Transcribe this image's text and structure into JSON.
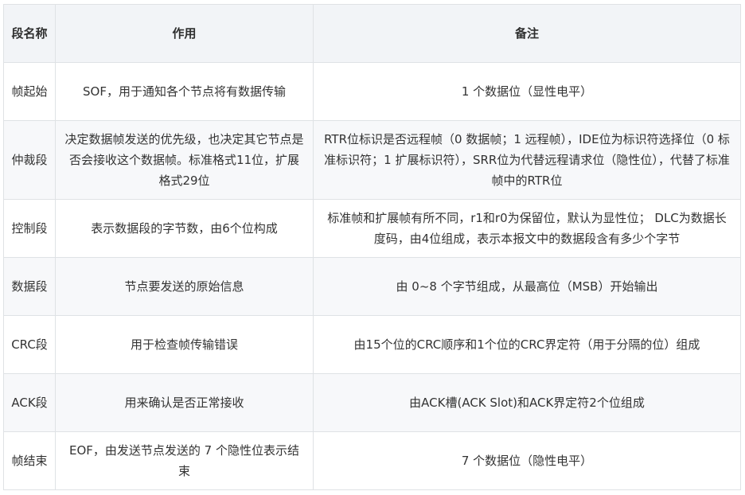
{
  "table": {
    "headers": [
      "段名称",
      "作用",
      "备注"
    ],
    "rows": [
      {
        "name": "帧起始",
        "purpose": "SOF，用于通知各个节点将有数据传输",
        "note": "1 个数据位（显性电平）"
      },
      {
        "name": "仲裁段",
        "purpose": "决定数据帧发送的优先级，也决定其它节点是否会接收这个数据帧。标准格式11位，扩展格式29位",
        "note": "RTR位标识是否远程帧（0 数据帧；1 远程帧），IDE位为标识符选择位（0 标准标识符；1 扩展标识符），SRR位为代替远程请求位（隐性位），代替了标准帧中的RTR位"
      },
      {
        "name": "控制段",
        "purpose": "表示数据段的字节数，由6个位构成",
        "note": "标准帧和扩展帧有所不同，r1和r0为保留位，默认为显性位； DLC为数据长度码，由4位组成，表示本报文中的数据段含有多少个字节"
      },
      {
        "name": "数据段",
        "purpose": "节点要发送的原始信息",
        "note": "由 0~8 个字节组成，从最高位（MSB）开始输出"
      },
      {
        "name": "CRC段",
        "purpose": "用于检查帧传输错误",
        "note": "由15个位的CRC顺序和1个位的CRC界定符（用于分隔的位）组成"
      },
      {
        "name": "ACK段",
        "purpose": "用来确认是否正常接收",
        "note": "由ACK槽(ACK Slot)和ACK界定符2个位组成"
      },
      {
        "name": "帧结束",
        "purpose": "EOF，由发送节点发送的 7 个隐性位表示结束",
        "note": "7 个数据位（隐性电平）"
      }
    ]
  }
}
